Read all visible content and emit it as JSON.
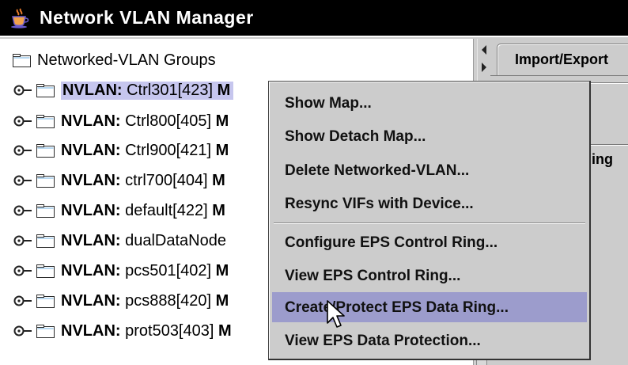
{
  "window": {
    "title": "Network VLAN Manager",
    "app_icon": "java-cup-icon"
  },
  "tree": {
    "root_label": "Networked-VLAN Groups",
    "items": [
      {
        "prefix": "NVLAN:",
        "name": " Ctrl301[423] ",
        "suffix": "M"
      },
      {
        "prefix": "NVLAN:",
        "name": " Ctrl800[405] ",
        "suffix": "M"
      },
      {
        "prefix": "NVLAN:",
        "name": " Ctrl900[421] ",
        "suffix": "M"
      },
      {
        "prefix": "NVLAN:",
        "name": " ctrl700[404] ",
        "suffix": "M"
      },
      {
        "prefix": "NVLAN:",
        "name": " default[422] ",
        "suffix": "M"
      },
      {
        "prefix": "NVLAN:",
        "name": " dualDataNode",
        "suffix": ""
      },
      {
        "prefix": "NVLAN:",
        "name": " pcs501[402] ",
        "suffix": "M"
      },
      {
        "prefix": "NVLAN:",
        "name": " pcs888[420] ",
        "suffix": "M"
      },
      {
        "prefix": "NVLAN:",
        "name": " prot503[403] ",
        "suffix": "M"
      }
    ]
  },
  "right_panel": {
    "tab_label": "Import/Export",
    "subtab_label": "ning"
  },
  "context_menu": {
    "items": [
      {
        "label": "Show Map..."
      },
      {
        "label": "Show Detach Map..."
      },
      {
        "label": "Delete Networked-VLAN..."
      },
      {
        "label": "Resync VIFs with Device..."
      },
      {
        "label": "Configure EPS Control Ring..."
      },
      {
        "label": "View EPS Control Ring..."
      },
      {
        "label": "Create/Protect EPS Data Ring..."
      },
      {
        "label": "View EPS Data Protection..."
      }
    ]
  },
  "colors": {
    "title_bar": "#000000",
    "selection": "#c6c6ee",
    "menu_highlight": "#9c9ccc",
    "panel_bg": "#cccccc"
  }
}
